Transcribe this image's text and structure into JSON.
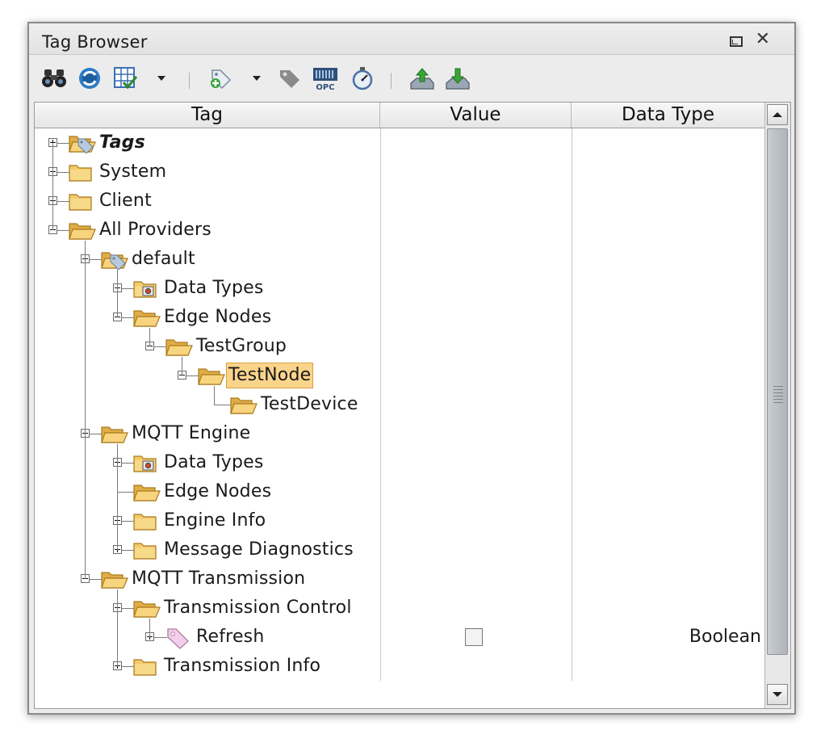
{
  "window": {
    "title": "Tag Browser"
  },
  "toolbar": {
    "icons": [
      "binoculars-icon",
      "refresh-icon",
      "table-check-icon",
      "dropdown-arrow-icon",
      "add-tag-icon",
      "dropdown-arrow-icon",
      "tag-grey-icon",
      "opc-icon",
      "stopwatch-icon",
      "export-icon",
      "import-icon"
    ],
    "opc_text": "OPC"
  },
  "columns": {
    "tag": "Tag",
    "value": "Value",
    "data_type": "Data Type"
  },
  "rows": [
    {
      "label": "Tags",
      "level": 0,
      "expander": "plus",
      "icon": "tag-folder-icon"
    },
    {
      "label": "System",
      "level": 0,
      "expander": "plus",
      "icon": "folder-icon"
    },
    {
      "label": "Client",
      "level": 0,
      "expander": "plus",
      "icon": "folder-icon"
    },
    {
      "label": "All Providers",
      "level": 0,
      "expander": "minus",
      "icon": "folder-open-icon"
    },
    {
      "label": "default",
      "level": 1,
      "expander": "minus",
      "icon": "tag-folder-icon"
    },
    {
      "label": "Data Types",
      "level": 2,
      "expander": "plus",
      "icon": "udt-folder-icon"
    },
    {
      "label": "Edge Nodes",
      "level": 2,
      "expander": "minus",
      "icon": "folder-open-icon"
    },
    {
      "label": "TestGroup",
      "level": 3,
      "expander": "minus",
      "icon": "folder-open-icon"
    },
    {
      "label": "TestNode",
      "level": 4,
      "expander": "minus",
      "icon": "folder-open-icon",
      "selected": true
    },
    {
      "label": "TestDevice",
      "level": 5,
      "expander": "none",
      "icon": "folder-open-icon"
    },
    {
      "label": "MQTT Engine",
      "level": 1,
      "expander": "minus",
      "icon": "folder-open-icon"
    },
    {
      "label": "Data Types",
      "level": 2,
      "expander": "plus",
      "icon": "udt-folder-icon"
    },
    {
      "label": "Edge Nodes",
      "level": 2,
      "expander": "none",
      "icon": "folder-open-icon"
    },
    {
      "label": "Engine Info",
      "level": 2,
      "expander": "plus",
      "icon": "folder-icon"
    },
    {
      "label": "Message Diagnostics",
      "level": 2,
      "expander": "plus",
      "icon": "folder-icon"
    },
    {
      "label": "MQTT Transmission",
      "level": 1,
      "expander": "minus",
      "icon": "folder-open-icon"
    },
    {
      "label": "Transmission Control",
      "level": 2,
      "expander": "minus",
      "icon": "folder-open-icon"
    },
    {
      "label": "Refresh",
      "level": 3,
      "expander": "plus",
      "icon": "tag-icon",
      "value": "unchecked",
      "data_type": "Boolean"
    },
    {
      "label": "Transmission Info",
      "level": 2,
      "expander": "plus",
      "icon": "folder-icon"
    }
  ]
}
